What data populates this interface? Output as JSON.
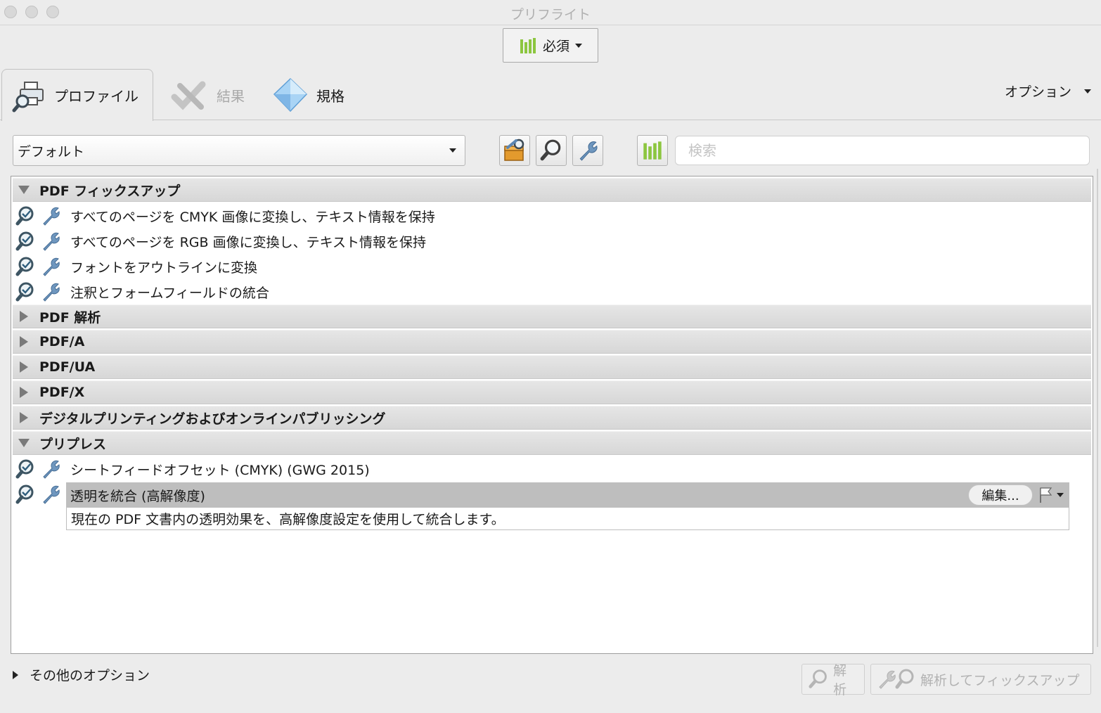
{
  "window": {
    "title": "プリフライト"
  },
  "mode_button": {
    "label": "必須"
  },
  "tabs": [
    {
      "label": "プロファイル",
      "active": true
    },
    {
      "label": "結果",
      "active": false,
      "disabled": true
    },
    {
      "label": "規格",
      "active": false
    }
  ],
  "options_menu": {
    "label": "オプション"
  },
  "toolbar": {
    "profile_select": "デフォルト",
    "search_placeholder": "検索"
  },
  "groups": {
    "fixups": {
      "label": "PDF フィックスアップ",
      "items": [
        "すべてのページを CMYK 画像に変換し、テキスト情報を保持",
        "すべてのページを RGB 画像に変換し、テキスト情報を保持",
        "フォントをアウトラインに変換",
        "注釈とフォームフィールドの統合"
      ]
    },
    "analysis": {
      "label": "PDF 解析"
    },
    "pdfa": {
      "label": "PDF/A"
    },
    "pdfua": {
      "label": "PDF/UA"
    },
    "pdfx": {
      "label": "PDF/X"
    },
    "digital": {
      "label": "デジタルプリンティングおよびオンラインパブリッシング"
    },
    "prepress": {
      "label": "プリプレス",
      "items": [
        "シートフィードオフセット (CMYK) (GWG 2015)",
        "透明を統合 (高解像度)"
      ]
    }
  },
  "selected_item": {
    "edit_label": "編集...",
    "description": "現在の PDF 文書内の透明効果を、高解像度設定を使用して統合します。"
  },
  "footer": {
    "more_options": "その他のオプション",
    "analyze": "解析",
    "analyze_fix": "解析してフィックスアップ"
  },
  "colors": {
    "accent_green": "#8cc63f",
    "wrench_blue": "#5b86b3",
    "selected_row": "#bebebe"
  }
}
